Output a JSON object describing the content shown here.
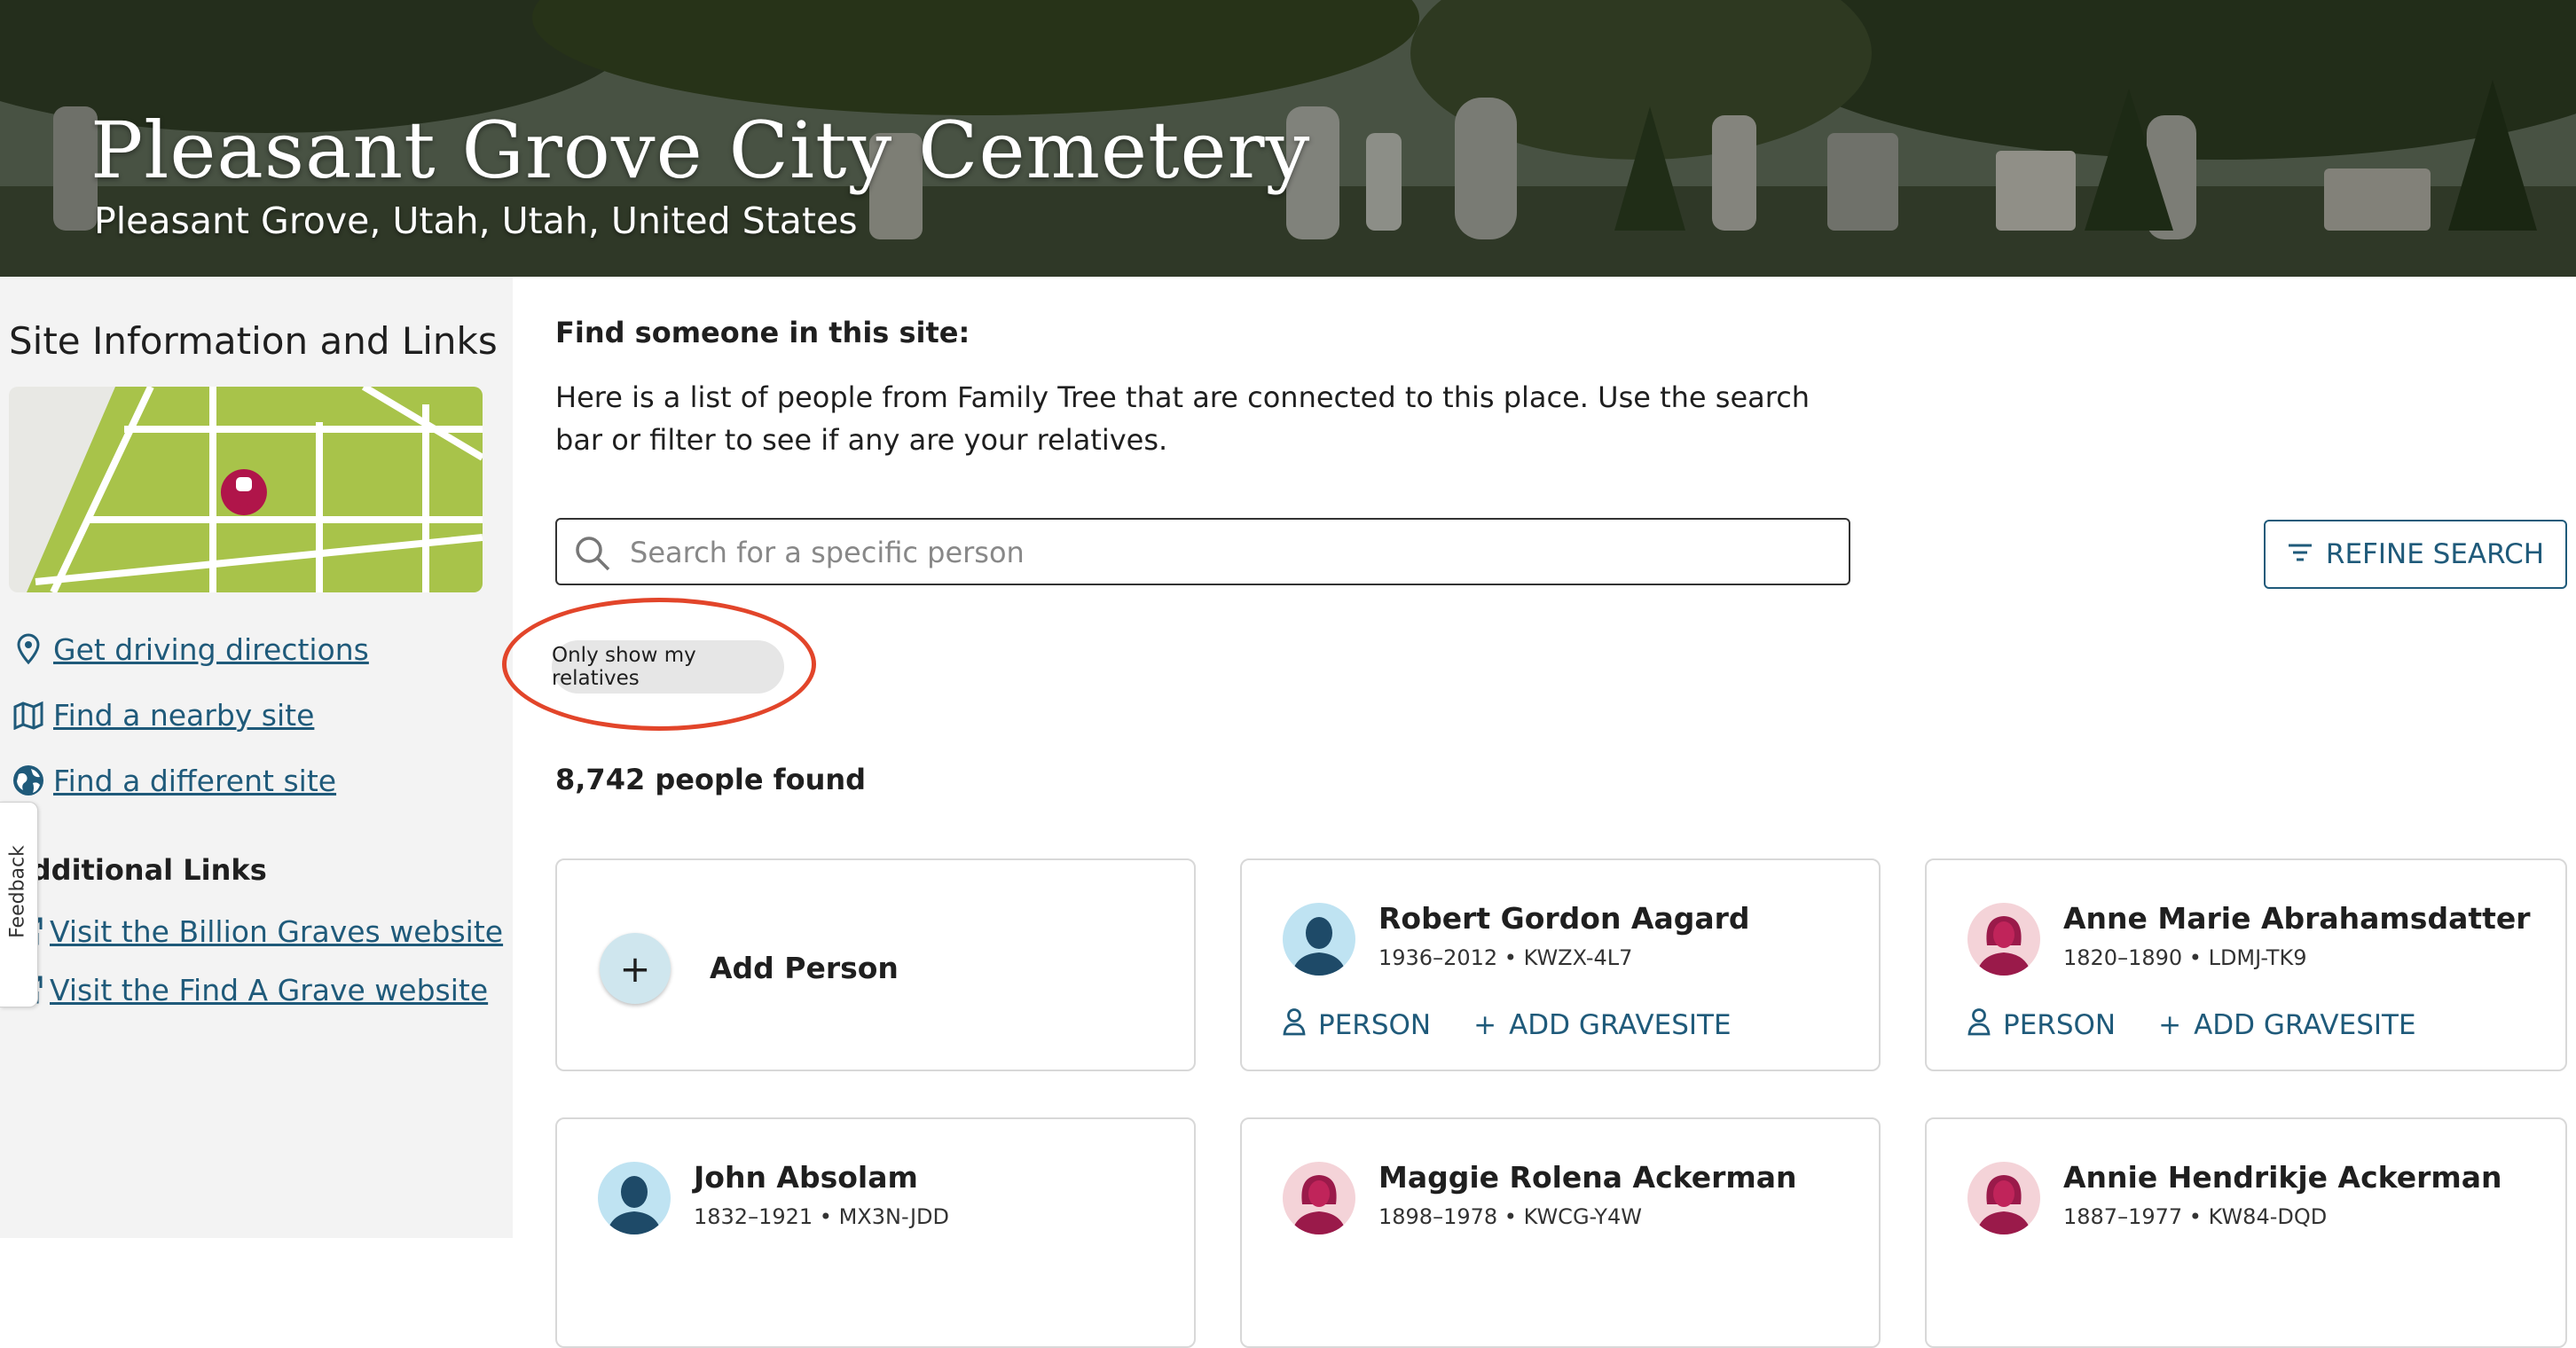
{
  "hero": {
    "title": "Pleasant Grove City Cemetery",
    "subtitle": "Pleasant Grove, Utah, Utah, United States"
  },
  "sidebar": {
    "title": "Site Information and Links",
    "links": [
      {
        "label": "Get driving directions",
        "icon": "map-pin-icon"
      },
      {
        "label": "Find a nearby site",
        "icon": "map-icon"
      },
      {
        "label": "Find a different site",
        "icon": "globe-icon"
      }
    ],
    "additional_title": "Additional Links",
    "additional_links": [
      {
        "label": "Visit the Billion Graves website",
        "icon": "external-link-icon"
      },
      {
        "label": "Visit the Find A Grave website",
        "icon": "external-link-icon"
      }
    ],
    "feedback_label": "Feedback"
  },
  "main": {
    "find_title": "Find someone in this site:",
    "find_desc": "Here is a list of people from Family Tree that are connected to this place.  Use the search bar or filter to see if any are your relatives.",
    "search": {
      "placeholder": "Search for a specific person",
      "value": ""
    },
    "refine_label": "REFINE SEARCH",
    "chip_label": "Only show my relatives",
    "count": "8,742 people found",
    "add_person_label": "Add Person",
    "person_label": "PERSON",
    "gravesite_label": "ADD GRAVESITE",
    "people": [
      {
        "name": "Robert Gordon Aagard",
        "meta": "1936–2012 • KWZX-4L7",
        "gender": "male"
      },
      {
        "name": "Anne Marie Abrahamsdatter",
        "meta": "1820–1890 • LDMJ-TK9",
        "gender": "female"
      },
      {
        "name": "John Absolam",
        "meta": "1832–1921 • MX3N-JDD",
        "gender": "male"
      },
      {
        "name": "Maggie Rolena Ackerman",
        "meta": "1898–1978 • KWCG-Y4W",
        "gender": "female"
      },
      {
        "name": "Annie Hendrikje Ackerman",
        "meta": "1887–1977 • KW84-DQD",
        "gender": "female"
      }
    ]
  },
  "colors": {
    "link": "#1f5a7a",
    "highlight_circle": "#e2452a",
    "map_green": "#a8c34a",
    "female_avatar_bg": "#f4d3d8",
    "male_avatar_bg": "#bfe3f2"
  }
}
